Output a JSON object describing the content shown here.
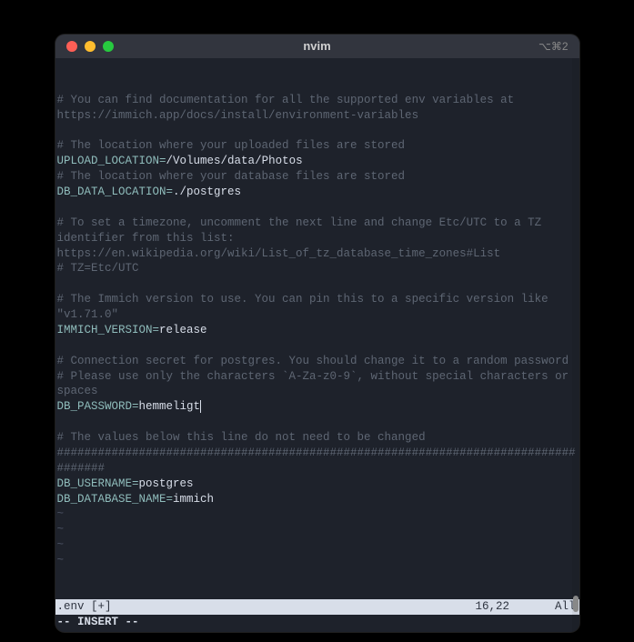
{
  "window": {
    "title": "nvim",
    "right_indicator": "⌥⌘2"
  },
  "content": {
    "comments": {
      "doc": "# You can find documentation for all the supported env variables at https://immich.app/docs/install/environment-variables",
      "upload_loc": "# The location where your uploaded files are stored",
      "db_loc": "# The location where your database files are stored",
      "tz1": "# To set a timezone, uncomment the next line and change Etc/UTC to a TZ identifier from this list: https://en.wikipedia.org/wiki/List_of_tz_database_time_zones#List",
      "tz2": "# TZ=Etc/UTC",
      "version": "# The Immich version to use. You can pin this to a specific version like \"v1.71.0\"",
      "conn1": "# Connection secret for postgres. You should change it to a random password",
      "conn2": "# Please use only the characters `A-Za-z0-9`, without special characters or spaces",
      "below": "# The values below this line do not need to be changed",
      "hashes": "###################################################################################"
    },
    "vars": {
      "upload_location": {
        "name": "UPLOAD_LOCATION",
        "value": "/Volumes/data/Photos"
      },
      "db_data_location": {
        "name": "DB_DATA_LOCATION",
        "value": "./postgres"
      },
      "immich_version": {
        "name": "IMMICH_VERSION",
        "value": "release"
      },
      "db_password": {
        "name": "DB_PASSWORD",
        "value": "hemmeligt"
      },
      "db_username": {
        "name": "DB_USERNAME",
        "value": "postgres"
      },
      "db_database_name": {
        "name": "DB_DATABASE_NAME",
        "value": "immich"
      }
    },
    "empty_marker": "~"
  },
  "status": {
    "filename": ".env [+]",
    "position": "16,22",
    "scroll": "All"
  },
  "mode": "-- INSERT --"
}
